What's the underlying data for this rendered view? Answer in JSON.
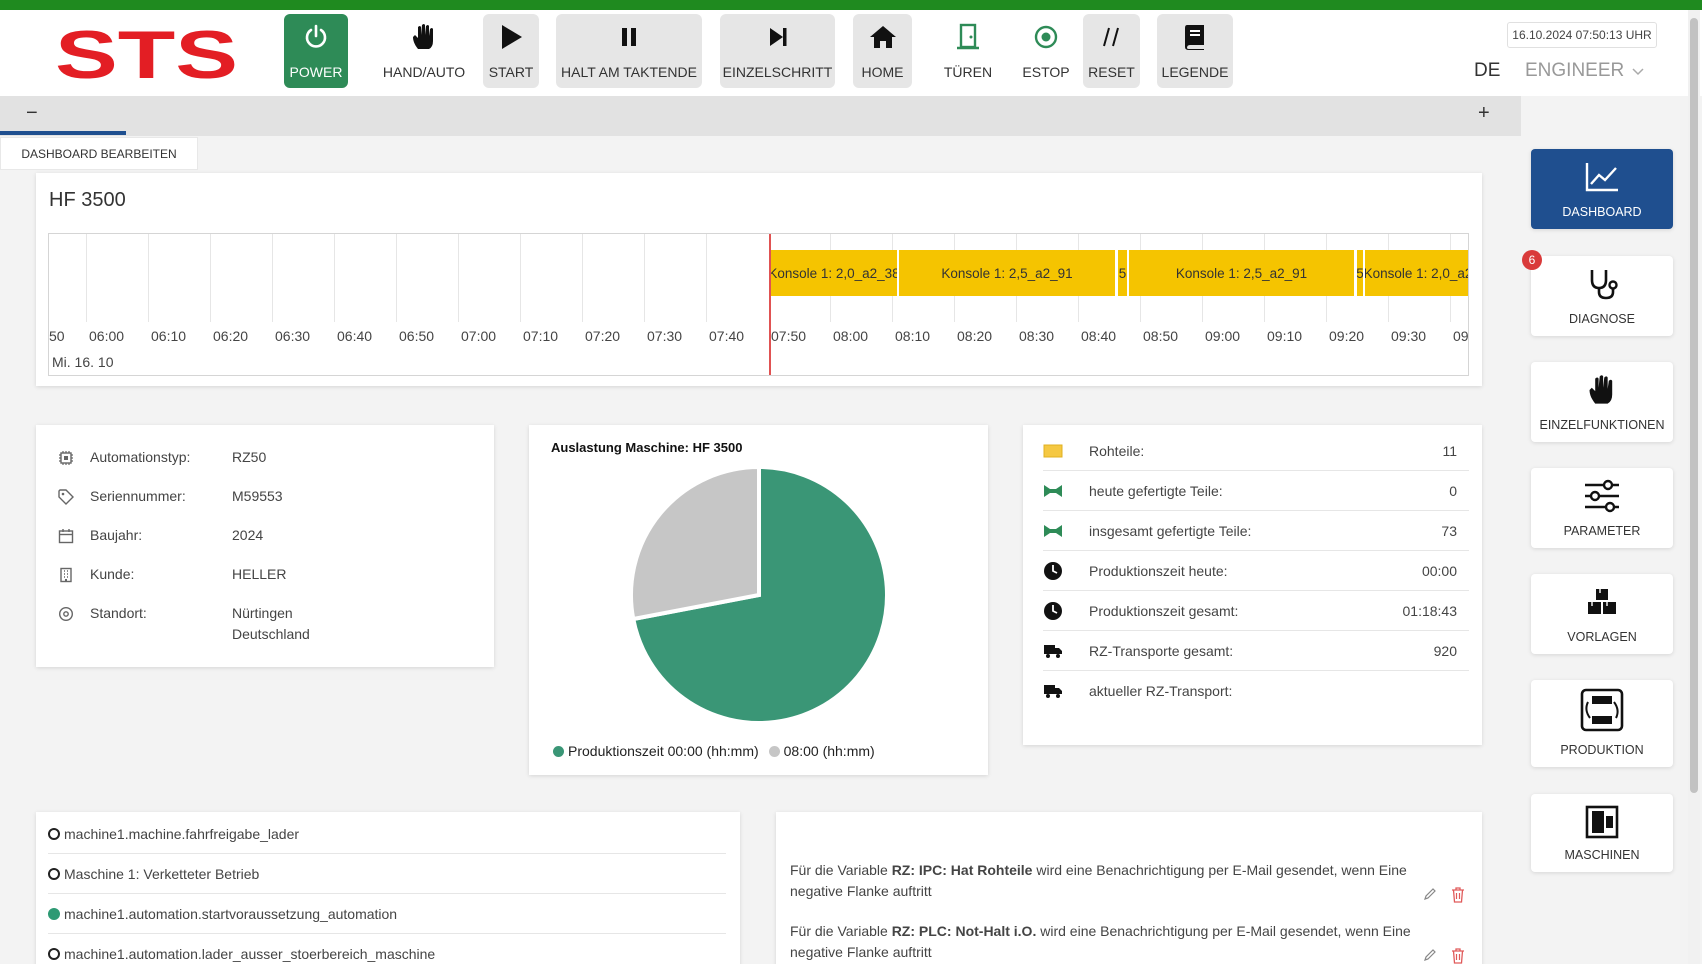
{
  "app": {
    "logo_text": "STS"
  },
  "toolbar": {
    "power": "POWER",
    "hand_auto": "HAND/AUTO",
    "start": "START",
    "halt": "HALT AM TAKTENDE",
    "einzelschritt": "EINZELSCHRITT",
    "home": "HOME",
    "tueren": "TÜREN",
    "estop": "ESTOP",
    "reset": "RESET",
    "legende": "LEGENDE"
  },
  "header": {
    "datetime": "16.10.2024 07:50:13 UHR",
    "lang": "DE",
    "role": "ENGINEER"
  },
  "tabs": {
    "minus": "−",
    "plus": "+"
  },
  "dashboard": {
    "edit_label": "DASHBOARD BEARBEITEN"
  },
  "timeline": {
    "title": "HF 3500",
    "date": "Mi. 16. 10",
    "ticks": [
      "50",
      "06:00",
      "06:10",
      "06:20",
      "06:30",
      "06:40",
      "06:50",
      "07:00",
      "07:10",
      "07:20",
      "07:30",
      "07:40",
      "07:50",
      "08:00",
      "08:10",
      "08:20",
      "08:30",
      "08:40",
      "08:50",
      "09:00",
      "09:10",
      "09:20",
      "09:30",
      "09:"
    ],
    "segments": [
      "Konsole 1: 2,0_a2_38",
      "Konsole 1: 2,5_a2_91",
      "5",
      "Konsole 1: 2,5_a2_91",
      "5",
      "Konsole 1: 2,0_a2"
    ]
  },
  "machine_info": {
    "rows": [
      {
        "label": "Automationstyp:",
        "value": "RZ50",
        "icon": "chip-icon"
      },
      {
        "label": "Seriennummer:",
        "value": "M59553",
        "icon": "tag-icon"
      },
      {
        "label": "Baujahr:",
        "value": "2024",
        "icon": "calendar-icon"
      },
      {
        "label": "Kunde:",
        "value": "HELLER",
        "icon": "building-icon"
      },
      {
        "label": "Standort:",
        "value": "Nürtingen",
        "value2": "Deutschland",
        "icon": "location-icon"
      }
    ]
  },
  "utilization": {
    "title": "Auslastung Maschine: HF 3500",
    "legend_a": "Produktionszeit 00:00 (hh:mm)",
    "legend_b": "08:00 (hh:mm)",
    "colors": {
      "production": "#3a9676",
      "idle": "#c6c6c6"
    }
  },
  "chart_data": {
    "type": "pie",
    "title": "Auslastung Maschine: HF 3500",
    "slices": [
      {
        "label": "Produktionszeit 00:00 (hh:mm)",
        "value": 72
      },
      {
        "label": "08:00 (hh:mm)",
        "value": 28
      }
    ]
  },
  "stats": {
    "rows": [
      {
        "label": "Rohteile:",
        "value": "11",
        "icon": "rohteile-icon"
      },
      {
        "label": "heute gefertigte Teile:",
        "value": "0",
        "icon": "parts-icon"
      },
      {
        "label": "insgesamt gefertigte Teile:",
        "value": "73",
        "icon": "parts-icon"
      },
      {
        "label": "Produktionszeit heute:",
        "value": "00:00",
        "icon": "clock-icon"
      },
      {
        "label": "Produktionszeit gesamt:",
        "value": "01:18:43",
        "icon": "clock-icon"
      },
      {
        "label": "RZ-Transporte gesamt:",
        "value": "920",
        "icon": "truck-icon"
      },
      {
        "label": "aktueller RZ-Transport:",
        "value": "",
        "icon": "truck-icon"
      }
    ]
  },
  "signals": [
    {
      "label": "machine1.machine.fahrfreigabe_lader",
      "active": false
    },
    {
      "label": "Maschine 1: Verketteter Betrieb",
      "active": false
    },
    {
      "label": "machine1.automation.startvoraussetzung_automation",
      "active": true
    },
    {
      "label": "machine1.automation.lader_ausser_stoerbereich_maschine",
      "active": false
    }
  ],
  "notifications": [
    {
      "pre": "Für die Variable ",
      "var": "RZ: IPC: Hat Rohteile",
      "post": " wird eine Benachrichtigung per E-Mail gesendet, wenn Eine negative Flanke auftritt"
    },
    {
      "pre": "Für die Variable ",
      "var": "RZ: PLC: Not-Halt i.O.",
      "post": " wird eine Benachrichtigung per E-Mail gesendet, wenn Eine negative Flanke auftritt"
    }
  ],
  "sidebar": {
    "dashboard": "DASHBOARD",
    "diagnose": "DIAGNOSE",
    "diagnose_badge": "6",
    "einzelfunktionen": "EINZELFUNKTIONEN",
    "parameter": "PARAMETER",
    "vorlagen": "VORLAGEN",
    "produktion": "PRODUKTION",
    "maschinen": "MASCHINEN"
  }
}
